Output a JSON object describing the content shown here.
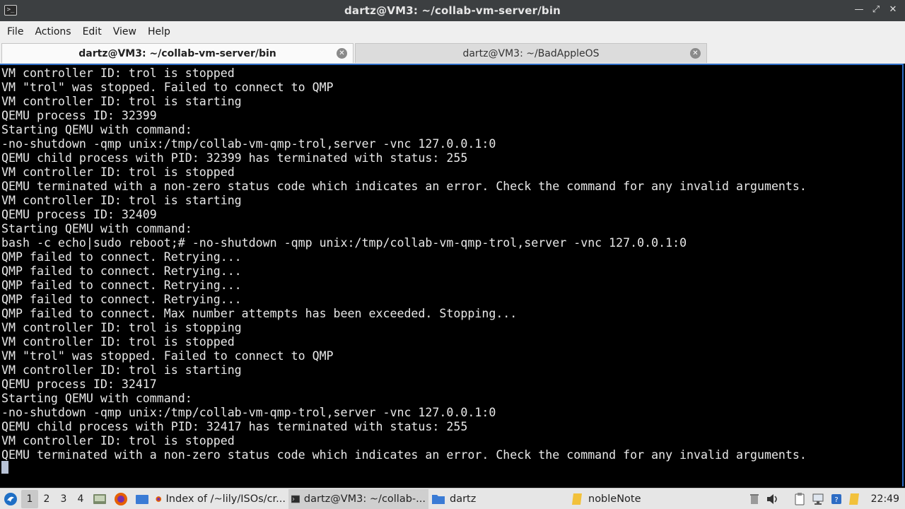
{
  "window": {
    "title": "dartz@VM3: ~/collab-vm-server/bin"
  },
  "menu": [
    "File",
    "Actions",
    "Edit",
    "View",
    "Help"
  ],
  "tabs": [
    {
      "label": "dartz@VM3: ~/collab-vm-server/bin",
      "active": true
    },
    {
      "label": "dartz@VM3: ~/BadAppleOS",
      "active": false
    }
  ],
  "terminal": {
    "lines": [
      "VM controller ID: trol is stopped",
      "VM \"trol\" was stopped. Failed to connect to QMP",
      "VM controller ID: trol is starting",
      "QEMU process ID: 32399",
      "Starting QEMU with command:",
      "-no-shutdown -qmp unix:/tmp/collab-vm-qmp-trol,server -vnc 127.0.0.1:0",
      "QEMU child process with PID: 32399 has terminated with status: 255",
      "VM controller ID: trol is stopped",
      "QEMU terminated with a non-zero status code which indicates an error. Check the command for any invalid arguments.",
      "VM controller ID: trol is starting",
      "QEMU process ID: 32409",
      "Starting QEMU with command:",
      "bash -c echo|sudo reboot;# -no-shutdown -qmp unix:/tmp/collab-vm-qmp-trol,server -vnc 127.0.0.1:0",
      "QMP failed to connect. Retrying...",
      "QMP failed to connect. Retrying...",
      "QMP failed to connect. Retrying...",
      "QMP failed to connect. Retrying...",
      "QMP failed to connect. Max number attempts has been exceeded. Stopping...",
      "VM controller ID: trol is stopping",
      "VM controller ID: trol is stopped",
      "VM \"trol\" was stopped. Failed to connect to QMP",
      "VM controller ID: trol is starting",
      "QEMU process ID: 32417",
      "Starting QEMU with command:",
      "-no-shutdown -qmp unix:/tmp/collab-vm-qmp-trol,server -vnc 127.0.0.1:0",
      "QEMU child process with PID: 32417 has terminated with status: 255",
      "VM controller ID: trol is stopped",
      "QEMU terminated with a non-zero status code which indicates an error. Check the command for any invalid arguments."
    ]
  },
  "taskbar": {
    "workspaces": [
      "1",
      "2",
      "3",
      "4"
    ],
    "active_workspace": "1",
    "tasks": [
      {
        "label": "Index of /~lily/ISOs/cr...",
        "icon": "firefox-icon"
      },
      {
        "label": "dartz@VM3: ~/collab-...",
        "icon": "terminal-icon"
      },
      {
        "label": "dartz",
        "icon": "folder-icon"
      },
      {
        "label": "nobleNote",
        "icon": "note-icon"
      }
    ],
    "clock": "22:49"
  },
  "colors": {
    "terminal_bg": "#000000",
    "terminal_fg": "#e8e8e8",
    "focus_border": "#2d6cc4",
    "titlebar_bg": "#3c3f41"
  }
}
